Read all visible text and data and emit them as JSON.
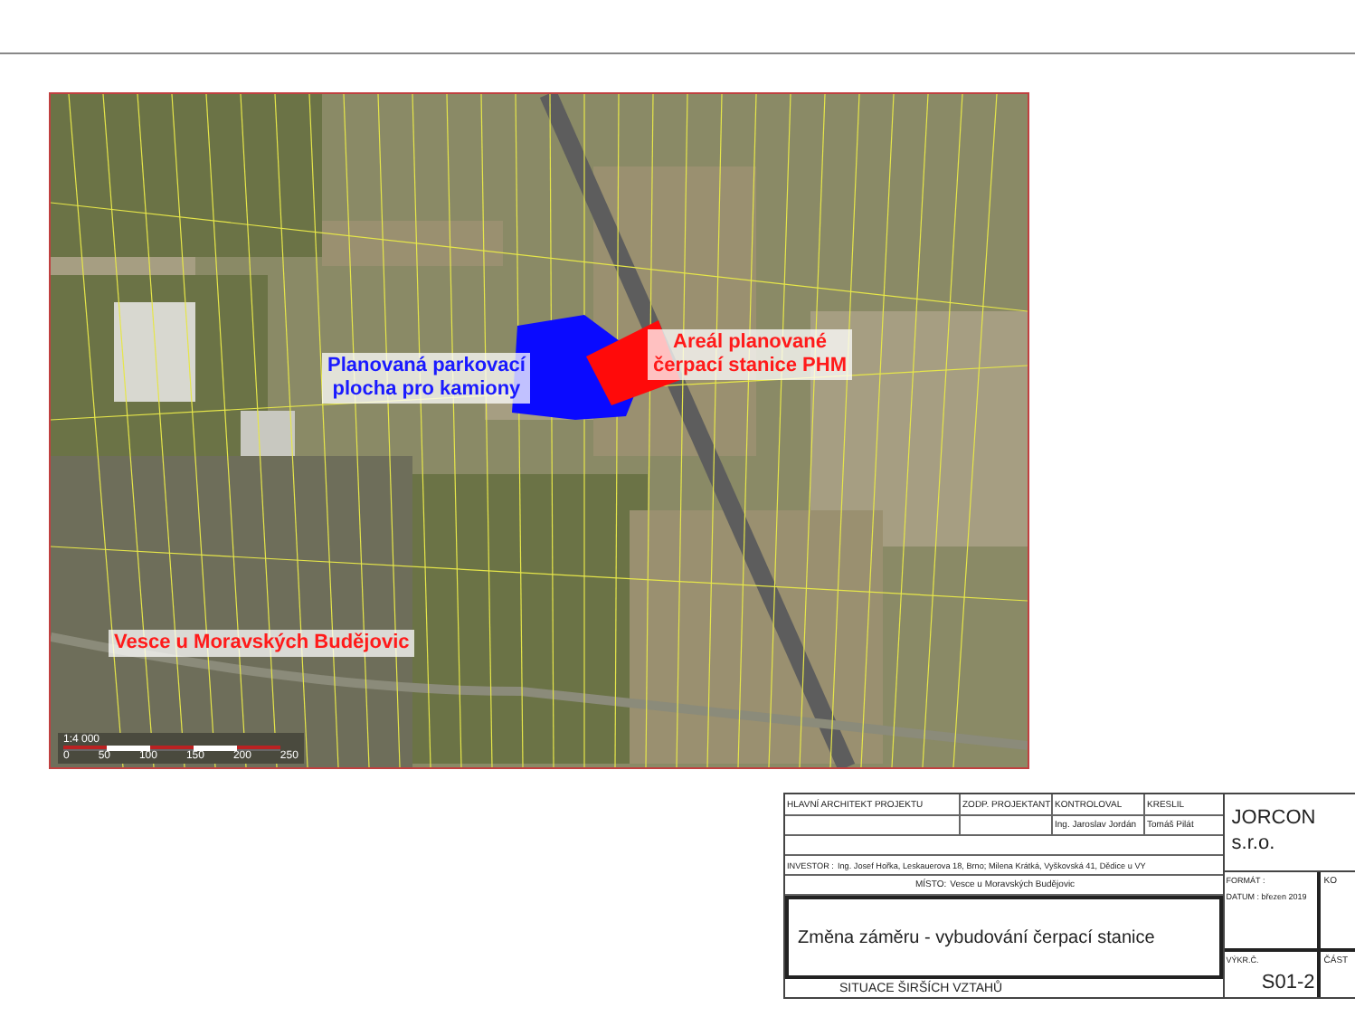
{
  "map": {
    "labels": [
      {
        "lines": [
          "Planovaná parkovací",
          "plocha pro kamiony"
        ],
        "color": "#1a1aff"
      },
      {
        "lines": [
          "Areál planované",
          "čerpací stanice PHM"
        ],
        "color": "#ff1a1a"
      },
      {
        "lines": [
          "Vesce u Moravských Budějovic"
        ],
        "color": "#ff1a1a"
      }
    ],
    "scale": {
      "ratio": "1:4 000",
      "ticks": [
        "0",
        "50",
        "100",
        "150",
        "200",
        "250"
      ]
    }
  },
  "title_block": {
    "header": [
      "HLAVNÍ ARCHITEKT PROJEKTU",
      "ZODP. PROJEKTANT",
      "KONTROLOVAL",
      "KRESLIL"
    ],
    "checker": "Ing. Jaroslav Jordán",
    "drafter": "Tomáš Pilát",
    "investor_label": "INVESTOR :",
    "investor": "Ing. Josef Hořka, Leskauerova 18, Brno; Milena Krátká, Vyškovská 41, Dědice u VY",
    "place_label": "MÍSTO:",
    "place": "Vesce u Moravských Budějovic",
    "company": "JORCON s.r.o.",
    "project": "Změna záměru - vybudování čerpací stanice",
    "format_label": "FORMÁT :",
    "column_cut": "KO",
    "date": "DATUM : březen 2019",
    "drawing_title": "SITUACE ŠIRŠÍCH VZTAHŮ",
    "number_label": "VÝKR.Č.",
    "number": "S01-2",
    "part_label": "ČÁST"
  }
}
